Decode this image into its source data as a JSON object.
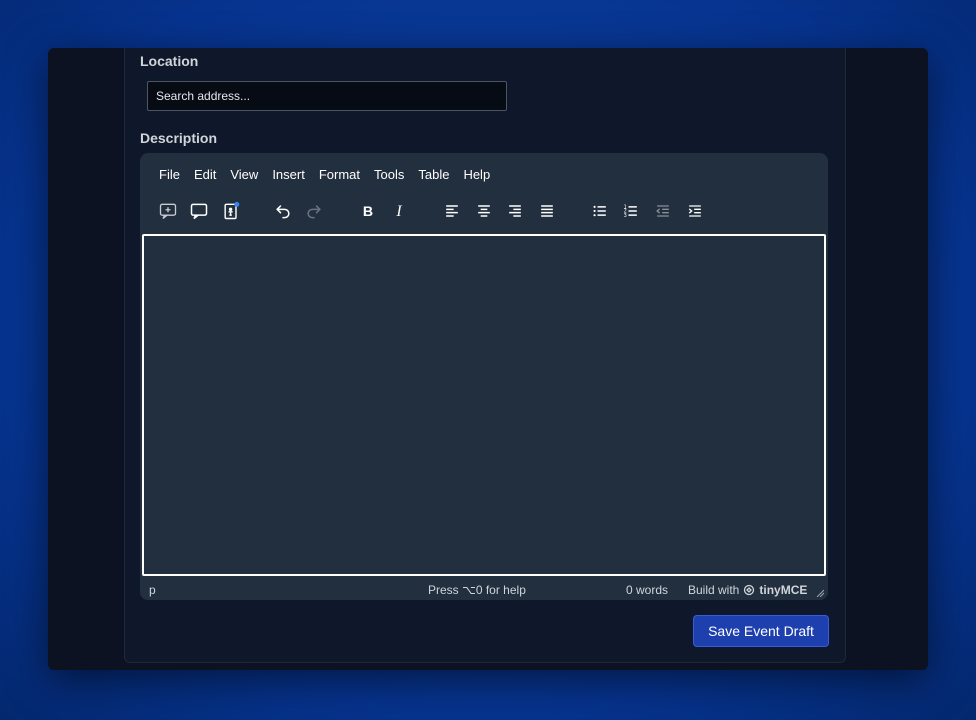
{
  "form": {
    "location_label": "Location",
    "location_placeholder": "Search address...",
    "description_label": "Description",
    "save_button": "Save Event Draft"
  },
  "editor": {
    "menu": [
      "File",
      "Edit",
      "View",
      "Insert",
      "Format",
      "Tools",
      "Table",
      "Help"
    ],
    "toolbar_icons": [
      "add-comment-icon",
      "comment-icon",
      "accessibility-checker-icon",
      "undo-icon",
      "redo-icon",
      "bold-icon",
      "italic-icon",
      "align-left-icon",
      "align-center-icon",
      "align-right-icon",
      "align-justify-icon",
      "bullet-list-icon",
      "numbered-list-icon",
      "outdent-icon",
      "indent-icon"
    ],
    "status": {
      "path": "p",
      "help": "Press ⌥0 for help",
      "words": "0 words",
      "build_prefix": "Build with",
      "brand": "tinyMCE"
    }
  },
  "colors": {
    "accent": "#1e40af",
    "notification_dot": "#3b82f6",
    "editor_bg": "#222f3e"
  }
}
